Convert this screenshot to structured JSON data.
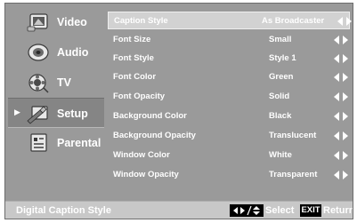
{
  "colors": {
    "screen_bg": "#9a9a9a",
    "highlight_row": "#d2d2d2",
    "active_nav": "#858585",
    "status_bar": "#c8c8c8",
    "text": "#ffffff",
    "key_bg": "#000000"
  },
  "sidebar": {
    "items": [
      {
        "label": "Video",
        "icon": "video-icon",
        "active": false
      },
      {
        "label": "Audio",
        "icon": "audio-icon",
        "active": false
      },
      {
        "label": "TV",
        "icon": "tv-icon",
        "active": false
      },
      {
        "label": "Setup",
        "icon": "setup-icon",
        "active": true
      },
      {
        "label": "Parental",
        "icon": "parental-icon",
        "active": false
      }
    ]
  },
  "menu": {
    "header": {
      "label": "Caption Style",
      "value": "As Broadcaster"
    },
    "rows": [
      {
        "label": "Font Size",
        "value": "Small"
      },
      {
        "label": "Font Style",
        "value": "Style 1"
      },
      {
        "label": "Font Color",
        "value": "Green"
      },
      {
        "label": "Font Opacity",
        "value": "Solid"
      },
      {
        "label": "Background Color",
        "value": "Black"
      },
      {
        "label": "Background Opacity",
        "value": "Translucent"
      },
      {
        "label": "Window Color",
        "value": "White"
      },
      {
        "label": "Window Opacity",
        "value": "Transparent"
      }
    ]
  },
  "status_bar": {
    "title": "Digital Caption Style",
    "select_label": "Select",
    "exit_key": "EXIT",
    "return_label": "Return"
  }
}
